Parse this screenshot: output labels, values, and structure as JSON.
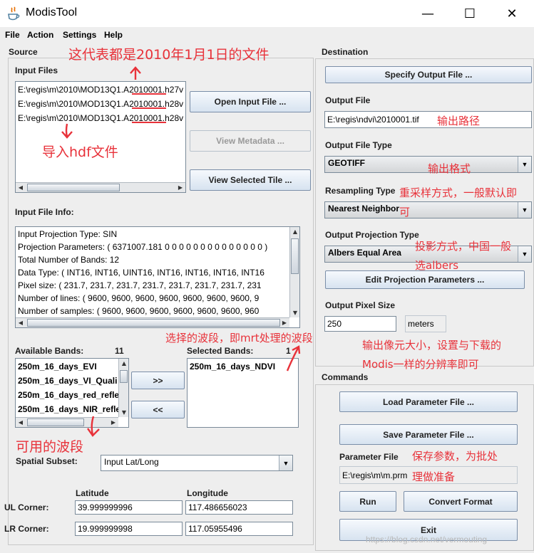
{
  "window": {
    "title": "ModisTool",
    "minimize": "—",
    "maximize": "☐",
    "close": "✕"
  },
  "menu": {
    "file": "File",
    "action": "Action",
    "settings": "Settings",
    "help": "Help"
  },
  "source": {
    "title": "Source",
    "input_files_label": "Input Files",
    "input_files": [
      {
        "prefix": "E:\\regis\\m\\2010\\MOD13Q1.A",
        "date": "2010001",
        "suffix": ".h27v"
      },
      {
        "prefix": "E:\\regis\\m\\2010\\MOD13Q1.A",
        "date": "2010001",
        "suffix": ".h28v"
      },
      {
        "prefix": "E:\\regis\\m\\2010\\MOD13Q1.A",
        "date": "2010001",
        "suffix": ".h28v"
      }
    ],
    "open_input_file": "Open Input File ...",
    "view_metadata": "View Metadata ...",
    "view_selected_tile": "View Selected Tile  ...",
    "input_file_info_label": "Input File Info:",
    "info_lines": [
      "Input Projection Type: SIN",
      "Projection Parameters: ( 6371007.181 0 0 0 0 0 0 0 0 0 0 0 0 0 0 )",
      "Total Number of Bands: 12",
      "Data Type: ( INT16, INT16, UINT16, INT16, INT16, INT16, INT16",
      "Pixel size: ( 231.7, 231.7, 231.7, 231.7, 231.7, 231.7, 231.7, 231",
      "Number of lines: ( 9600, 9600, 9600, 9600, 9600, 9600, 9600, 9",
      "Number of samples: ( 9600, 9600, 9600, 9600, 9600, 9600, 960"
    ],
    "available_bands_label": "Available Bands:",
    "available_count": "11",
    "available_bands": [
      "250m_16_days_EVI",
      "250m_16_days_VI_Quali",
      "250m_16_days_red_refle",
      "250m_16_days_NIR_refle"
    ],
    "add_button": ">>",
    "remove_button": "<<",
    "selected_bands_label": "Selected Bands:",
    "selected_count": "1",
    "selected_bands": [
      "250m_16_days_NDVI"
    ],
    "spatial_subset_label": "Spatial Subset:",
    "spatial_subset_value": "Input Lat/Long",
    "latitude_label": "Latitude",
    "longitude_label": "Longitude",
    "ul_label": "UL Corner:",
    "lr_label": "LR Corner:",
    "ul_lat": "39.999999996",
    "ul_lon": "117.486656023",
    "lr_lat": "19.999999998",
    "lr_lon": "117.05955496"
  },
  "destination": {
    "title": "Destination",
    "specify_output_file": "Specify Output File ...",
    "output_file_label": "Output File",
    "output_file_value": "E:\\regis\\ndvi\\2010001.tif",
    "output_file_type_label": "Output File Type",
    "output_file_type_value": "GEOTIFF",
    "resampling_label": "Resampling Type",
    "resampling_value": "Nearest Neighbor",
    "projection_label": "Output Projection Type",
    "projection_value": "Albers Equal Area",
    "edit_projection": "Edit Projection Parameters ...",
    "pixel_size_label": "Output Pixel Size",
    "pixel_size_value": "250",
    "pixel_unit": "meters"
  },
  "commands": {
    "title": "Commands",
    "load_parameter_file": "Load Parameter File ...",
    "save_parameter_file": "Save Parameter File ...",
    "parameter_file_label": "Parameter File",
    "parameter_file_value": "E:\\regis\\m\\m.prm",
    "run": "Run",
    "convert_format": "Convert Format",
    "exit": "Exit"
  },
  "annotations": {
    "date_note": "这代表都是2010年1月1日的文件",
    "import_note": "导入hdf文件",
    "output_path_note": "输出路径",
    "output_format_note": "输出格式",
    "resampling_note_1": "重采样方式，一般默认即",
    "resampling_note_2": "可",
    "projection_note_1": "投影方式，中国一般",
    "projection_note_2": "选albers",
    "bands_note": "选择的波段，即mrt处理的波段",
    "pixel_note_1": "输出像元大小，设置与下载的",
    "pixel_note_2": "Modis一样的分辨率即可",
    "available_note": "可用的波段",
    "param_note_1": "保存参数，为批处",
    "param_note_2": "理做准备"
  },
  "watermark": "https://blog.csdn.net/vermouting",
  "accent_color": "#e8323a"
}
